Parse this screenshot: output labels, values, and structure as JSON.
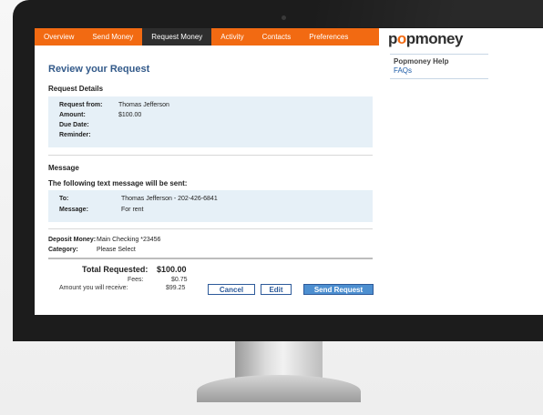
{
  "nav": {
    "items": [
      {
        "label": "Overview"
      },
      {
        "label": "Send Money"
      },
      {
        "label": "Request Money",
        "active": true
      },
      {
        "label": "Activity"
      },
      {
        "label": "Contacts"
      },
      {
        "label": "Preferences"
      }
    ]
  },
  "page": {
    "title": "Review your Request"
  },
  "request_details": {
    "heading": "Request Details",
    "request_from_label": "Request from:",
    "request_from_value": "Thomas Jefferson",
    "amount_label": "Amount:",
    "amount_value": "$100.00",
    "due_date_label": "Due Date:",
    "reminder_label": "Reminder:"
  },
  "message": {
    "heading": "Message",
    "subheading": "The following text message will be sent:",
    "to_label": "To:",
    "to_value": "Thomas Jefferson - 202-426-6841",
    "message_label": "Message:",
    "message_value": "For rent"
  },
  "deposit": {
    "deposit_label": "Deposit Money:",
    "deposit_value": "Main Checking *23456",
    "category_label": "Category:",
    "category_value": "Please Select"
  },
  "totals": {
    "total_label": "Total Requested:",
    "total_value": "$100.00",
    "fees_label": "Fees:",
    "fees_value": "$0.75",
    "receive_label": "Amount you will receive:",
    "receive_value": "$99.25"
  },
  "buttons": {
    "cancel": "Cancel",
    "edit": "Edit",
    "send": "Send Request"
  },
  "sidebar": {
    "logo_parts": [
      "p",
      "o",
      "p",
      "money"
    ],
    "help_label": "Popmoney Help",
    "faq_label": "FAQs"
  },
  "colors": {
    "brand_orange": "#f26a12",
    "accent_blue": "#4d8fd0",
    "panel_blue": "#e6f0f7"
  }
}
